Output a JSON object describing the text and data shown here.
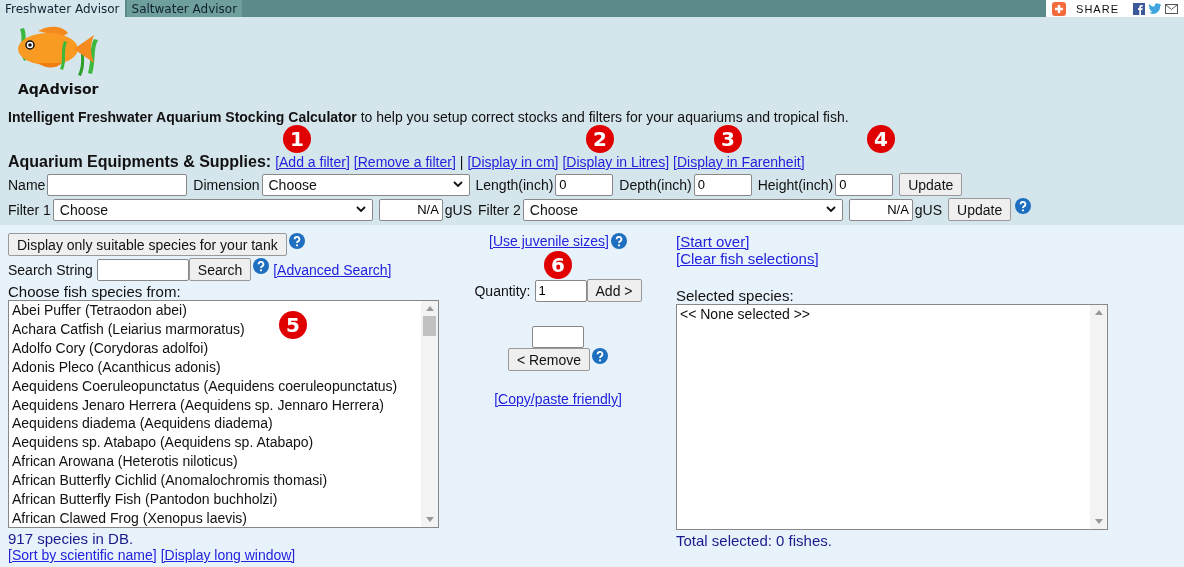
{
  "tabs": [
    {
      "label": "Freshwater Advisor",
      "selected": true
    },
    {
      "label": "Saltwater Advisor",
      "selected": false
    }
  ],
  "share": {
    "label": "SHARE"
  },
  "logo": {
    "text": "AqAdvisor"
  },
  "intro": "**Intelligent Freshwater Aquarium Stocking Calculator** to help you setup correct stocks and filters for your aquariums and tropical fish.",
  "equipment": {
    "heading": "Aquarium Equipments & Supplies:",
    "markers": [
      "1",
      "2",
      "3",
      "4"
    ],
    "links": [
      {
        "kind": "link",
        "text": "[Add a filter]"
      },
      {
        "kind": "link",
        "text": "[Remove a filter]"
      },
      {
        "kind": "separator",
        "text": "|"
      },
      {
        "kind": "link",
        "text": "[Display in cm]"
      },
      {
        "kind": "link",
        "text": "[Display in Litres]"
      },
      {
        "kind": "link",
        "text": "[Display in Farenheit]"
      }
    ]
  },
  "dimension_row": {
    "name_label": "Name",
    "dimension_label": "Dimension",
    "dimension_value": "Choose",
    "fields": [
      {
        "label": "Length(inch)",
        "value": "0"
      },
      {
        "label": "Depth(inch)",
        "value": "0"
      },
      {
        "label": "Height(inch)",
        "value": "0"
      }
    ],
    "button": "Update"
  },
  "filter_row": {
    "filters": [
      {
        "label": "Filter 1",
        "value": "Choose",
        "capacity": "N/A",
        "unit": "gUS"
      },
      {
        "label": "Filter 2",
        "value": "Choose",
        "capacity": "N/A",
        "unit": "gUS"
      }
    ],
    "button": "Update"
  },
  "species": {
    "suitable_button": "Display only suitable species for your tank",
    "search_label": "Search String",
    "search_button": "Search",
    "advanced_link": "[Advanced Search]",
    "list_label": "Choose fish species from:",
    "marker": "5",
    "items": [
      "Abei Puffer (Tetraodon abei)",
      "Achara Catfish (Leiarius marmoratus)",
      "Adolfo Cory (Corydoras adolfoi)",
      "Adonis Pleco (Acanthicus adonis)",
      "Aequidens Coeruleopunctatus (Aequidens coeruleopunctatus)",
      "Aequidens Jenaro Herrera (Aequidens sp. Jennaro Herrera)",
      "Aequidens diadema (Aequidens diadema)",
      "Aequidens sp. Atabapo (Aequidens sp. Atabapo)",
      "African Arowana (Heterotis niloticus)",
      "African Butterfly Cichlid (Anomalochromis thomasi)",
      "African Butterfly Fish (Pantodon buchholzi)",
      "African Clawed Frog (Xenopus laevis)"
    ],
    "count": "917 species in DB.",
    "links": [
      "[Sort by scientific name]",
      "[Display long window]"
    ]
  },
  "middle": {
    "juvenile_link": "[Use juvenile sizes]",
    "marker": "6",
    "quantity_label": "Quantity:",
    "quantity_value": "1",
    "add_button": "Add >",
    "remove_button": "< Remove",
    "copy_link": "[Copy/paste friendly]"
  },
  "selection": {
    "links": [
      "[Start over]",
      "[Clear fish selections]"
    ],
    "label": "Selected species:",
    "items": [
      "<< None selected >>"
    ],
    "total": "Total selected: 0 fishes."
  }
}
